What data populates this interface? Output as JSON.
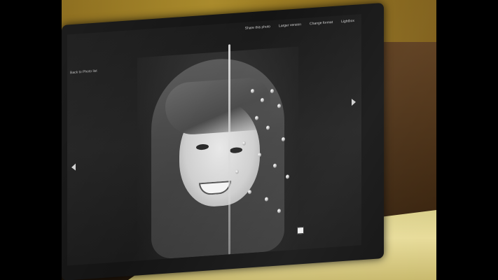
{
  "photo": {
    "screen_toolbar": {
      "items": [
        "Share this photo",
        "Larger version",
        "Change format",
        "Lightbox"
      ]
    },
    "screen_back_link": "Back to Photo list",
    "nav_prev_icon": "chevron-left-icon",
    "nav_next_icon": "chevron-right-icon",
    "cursor_icon": "cursor-icon"
  }
}
